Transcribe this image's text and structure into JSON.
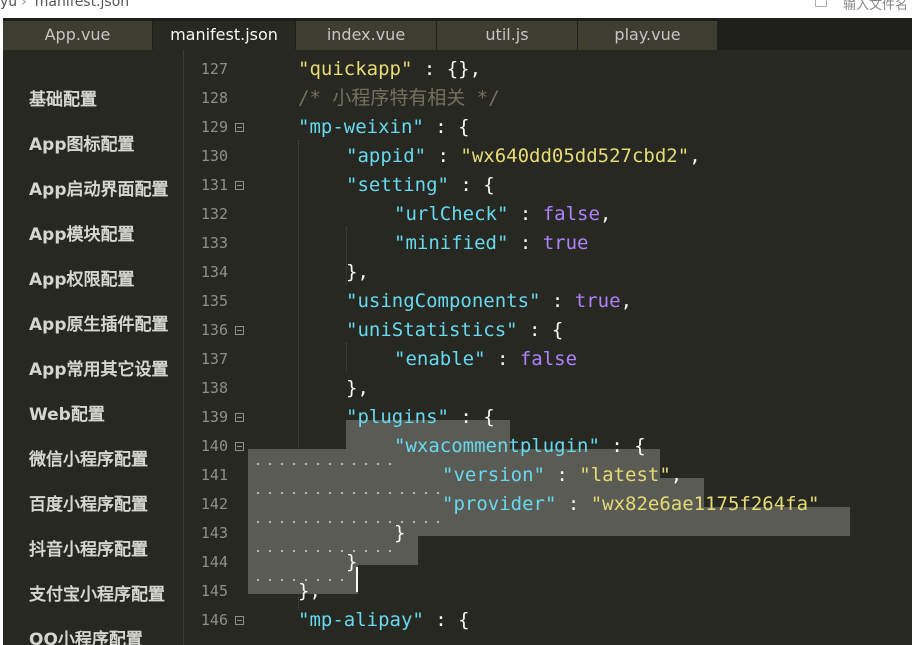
{
  "breadcrumb": {
    "folder": "yu",
    "file": "manifest.json",
    "search_placeholder": "输入文件名"
  },
  "tabs": [
    "App.vue",
    "manifest.json",
    "index.vue",
    "util.js",
    "play.vue"
  ],
  "active_tab": "manifest.json",
  "sidebar": [
    "基础配置",
    "App图标配置",
    "App启动界面配置",
    "App模块配置",
    "App权限配置",
    "App原生插件配置",
    "App常用其它设置",
    "Web配置",
    "微信小程序配置",
    "百度小程序配置",
    "抖音小程序配置",
    "支付宝小程序配置",
    "QQ小程序配置"
  ],
  "line_numbers": [
    "127",
    "128",
    "129",
    "130",
    "131",
    "132",
    "133",
    "134",
    "135",
    "136",
    "137",
    "138",
    "139",
    "140",
    "141",
    "142",
    "143",
    "144",
    "145",
    "146"
  ],
  "code": {
    "quickapp_key": "\"quickapp\"",
    "quickapp_val": " : {},",
    "comment": "/* 小程序特有相关 */",
    "mpweixin_key": "\"mp-weixin\"",
    "appid_key": "\"appid\"",
    "appid_val": "\"wx640dd05dd527cbd2\"",
    "setting_key": "\"setting\"",
    "urlcheck_key": "\"urlCheck\"",
    "urlcheck_val": "false",
    "minified_key": "\"minified\"",
    "minified_val": "true",
    "usingcomp_key": "\"usingComponents\"",
    "usingcomp_val": "true",
    "unistat_key": "\"uniStatistics\"",
    "enable_key": "\"enable\"",
    "enable_val": "false",
    "plugins_key": "\"plugins\"",
    "plugin_name_key": "\"wxacommentplugin\"",
    "version_key": "\"version\"",
    "version_val": "\"latest\"",
    "provider_key": "\"provider\"",
    "provider_val": "\"wx82e6ae1175f264fa\"",
    "mpalipay_key": "\"mp-alipay\"",
    "open": " : {",
    "sep": " : ",
    "close": "}",
    "close_comma": "},",
    "comma": ","
  }
}
